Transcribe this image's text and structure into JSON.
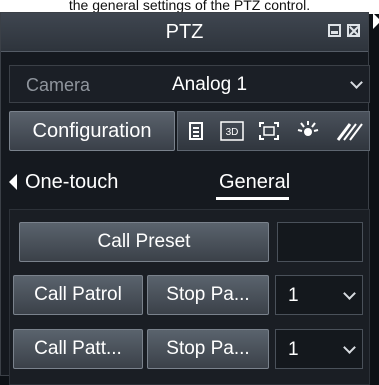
{
  "caption": "the general settings of the PTZ control.",
  "window": {
    "title": "PTZ"
  },
  "camera": {
    "label": "Camera",
    "value": "Analog 1"
  },
  "configuration_button": "Configuration",
  "tabs": [
    {
      "label": "One-touch",
      "active": false
    },
    {
      "label": "General",
      "active": true
    }
  ],
  "general": {
    "call_preset": "Call Preset",
    "call_patrol": "Call Patrol",
    "stop_patrol": "Stop Pa...",
    "patrol_number": "1",
    "call_pattern": "Call Patt...",
    "stop_pattern": "Stop Pa...",
    "pattern_number": "1"
  },
  "icons": [
    "list-icon",
    "3d-icon",
    "fullscreen-icon",
    "light-icon",
    "wiper-icon"
  ],
  "colors": {
    "background": "#15191f",
    "button": "#4a525c",
    "text": "#ffffff"
  }
}
